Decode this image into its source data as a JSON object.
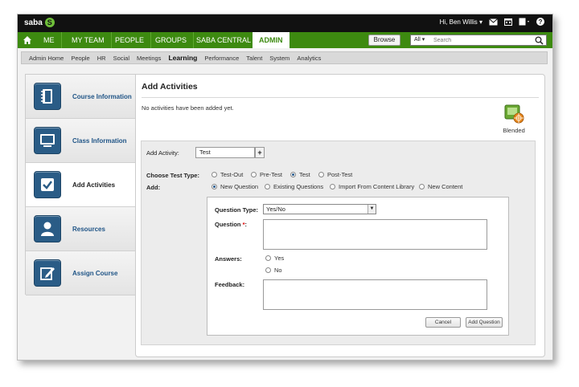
{
  "brand": {
    "logo_text": "saba",
    "logo_mark": "S"
  },
  "user": {
    "greeting": "Hi, Ben Willis"
  },
  "nav": {
    "items": [
      "ME",
      "MY TEAM",
      "PEOPLE",
      "GROUPS",
      "SABA CENTRAL",
      "ADMIN"
    ],
    "active": "ADMIN",
    "browse_label": "Browse",
    "search_scope": "All",
    "search_placeholder": "Search"
  },
  "subnav": {
    "items": [
      "Admin Home",
      "People",
      "HR",
      "Social",
      "Meetings",
      "Learning",
      "Performance",
      "Talent",
      "System",
      "Analytics"
    ],
    "active": "Learning"
  },
  "rail": {
    "items": [
      {
        "label": "Course Information",
        "icon": "notebook-icon"
      },
      {
        "label": "Class Information",
        "icon": "monitor-icon"
      },
      {
        "label": "Add Activities",
        "icon": "checkbox-icon"
      },
      {
        "label": "Resources",
        "icon": "person-icon"
      },
      {
        "label": "Assign Course",
        "icon": "edit-icon"
      }
    ],
    "active": "Add Activities"
  },
  "main": {
    "title": "Add Activities",
    "empty_message": "No activities have been added yet.",
    "blended_label": "Blended",
    "form": {
      "add_activity_label": "Add Activity:",
      "add_activity_value": "Test",
      "add_button": "+",
      "test_type_label": "Choose Test Type:",
      "test_types": [
        "Test-Out",
        "Pre-Test",
        "Test",
        "Post-Test"
      ],
      "test_type_selected": "Test",
      "add_label": "Add:",
      "add_options": [
        "New Question",
        "Existing Questions",
        "Import From Content Library",
        "New Content"
      ],
      "add_selected": "New Question",
      "question_type_label": "Question Type:",
      "question_type_value": "Yes/No",
      "question_label": "Question",
      "required_mark": "*",
      "question_colon": ":",
      "answers_label": "Answers:",
      "answers": [
        "Yes",
        "No"
      ],
      "feedback_label": "Feedback:",
      "cancel_label": "Cancel",
      "add_question_label": "Add Question"
    }
  },
  "colors": {
    "accent_green": "#3d8a10",
    "rail_icon_blue": "#2a5c86",
    "link_blue": "#1f5486"
  }
}
